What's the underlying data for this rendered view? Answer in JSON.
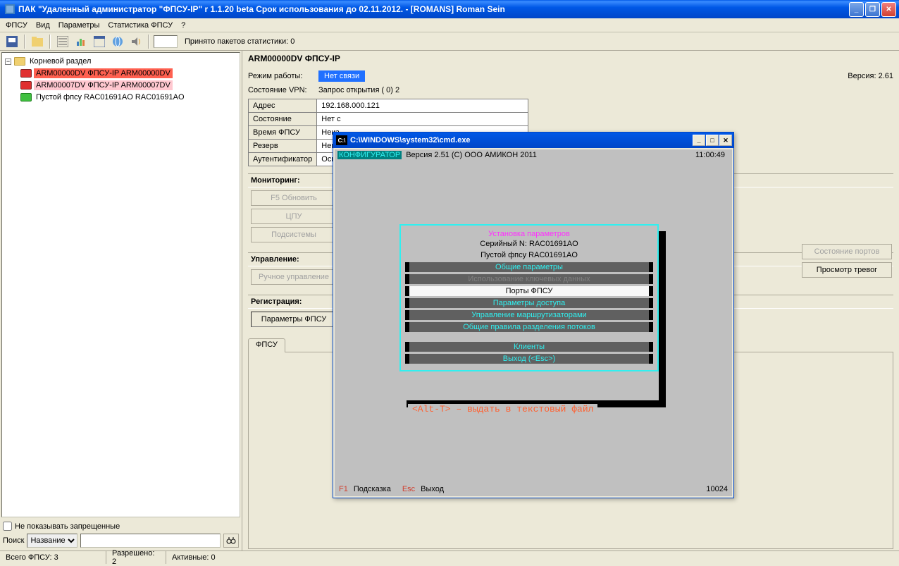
{
  "window": {
    "title": "ПАК \"Удаленный администратор \"ФПСУ-IP\" r 1.1.20 beta  Срок использования до 02.11.2012. - [ROMANS] Roman Sein"
  },
  "menubar": {
    "items": [
      "ФПСУ",
      "Вид",
      "Параметры",
      "Статистика ФПСУ",
      "?"
    ]
  },
  "toolbar": {
    "stats_label": "Принято пакетов статистики:  0"
  },
  "tree": {
    "root": "Корневой раздел",
    "items": [
      {
        "label": "ARM00000DV ФПСУ-IP ARM00000DV",
        "sel": "sel-red"
      },
      {
        "label": "ARM00007DV ФПСУ-IP ARM00007DV",
        "sel": "sel-pink"
      },
      {
        "label": "Пустой фпсу RAC01691AO RAC01691AO",
        "sel": ""
      }
    ],
    "hide_denied_label": "Не показывать запрещенные",
    "search_label": "Поиск",
    "search_mode": "Название"
  },
  "detail": {
    "title": "ARM00000DV ФПСУ-IP",
    "mode_label": "Режим работы:",
    "mode_value": "Нет связи",
    "version_label": "Версия: 2.61",
    "vpn_label": "Состояние VPN:",
    "vpn_value": "Запрос открытия ( 0) 2",
    "props": [
      {
        "k": "Адрес",
        "v": "192.168.000.121"
      },
      {
        "k": "Состояние",
        "v": "Нет с"
      },
      {
        "k": "Время ФПСУ",
        "v": "Неиз"
      },
      {
        "k": "Резерв",
        "v": "Неиз"
      },
      {
        "k": "Аутентификатор",
        "v": "Осно"
      }
    ],
    "grp_monitor": "Мониторинг:",
    "btn_refresh": "F5 Обновить",
    "btn_cpu": "ЦПУ",
    "btn_subsys": "Подсистемы",
    "grp_manage": "Управление:",
    "btn_manual": "Ручное управление",
    "grp_register": "Регистрация:",
    "btn_params": "Параметры ФПСУ",
    "btn_ports": "Состояние портов",
    "btn_alarms": "Просмотр тревог",
    "tab_fpsu": "ФПСУ"
  },
  "cmd": {
    "title": "C:\\WINDOWS\\system32\\cmd.exe",
    "konfig": "КОНФИГУРАТОР",
    "ver": "Версия 2.51   (C) ООО АМИКОН 2011",
    "time": "11:00:49",
    "menu_title": "Установка параметров",
    "serial": "Серийный N: RAC01691AO",
    "empty": "Пустой фпсу RAC01691AO",
    "options": [
      "Общие параметры",
      "Использование ключевых данных",
      "Порты ФПСУ",
      "Параметры доступа",
      "Управление маршрутизаторами",
      "Общие правила разделения потоков",
      "Клиенты",
      "Выход (<Esc>)"
    ],
    "hint": "<Alt-T> – выдать в текстовый файл",
    "f1": "F1",
    "f1txt": "Подсказка",
    "esc": "Esc",
    "esctxt": "Выход",
    "num": "10024"
  },
  "statusbar": {
    "total": "Всего ФПСУ: 3",
    "allowed": "Разрешено: 2",
    "active": "Активные: 0"
  }
}
